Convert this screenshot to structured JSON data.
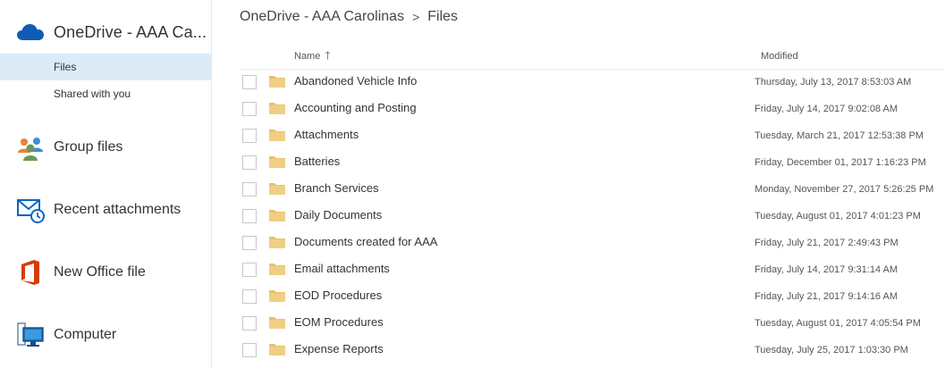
{
  "sidebar": {
    "app_title": "OneDrive - AAA Ca...",
    "sub_items": [
      {
        "label": "Files",
        "selected": true
      },
      {
        "label": "Shared with you",
        "selected": false
      }
    ],
    "nav_items": [
      {
        "label": "Group files",
        "icon": "group-icon"
      },
      {
        "label": "Recent attachments",
        "icon": "mail-clock-icon"
      },
      {
        "label": "New Office file",
        "icon": "office-icon"
      },
      {
        "label": "Computer",
        "icon": "computer-icon"
      }
    ]
  },
  "breadcrumb": {
    "root": "OneDrive - AAA Carolinas",
    "separator": ">",
    "current": "Files"
  },
  "list": {
    "columns": {
      "name": "Name",
      "name_sort_arrow": "🡑",
      "modified": "Modified"
    },
    "rows": [
      {
        "name": "Abandoned Vehicle Info",
        "modified": "Thursday, July 13, 2017 8:53:03 AM"
      },
      {
        "name": "Accounting and Posting",
        "modified": "Friday, July 14, 2017 9:02:08 AM"
      },
      {
        "name": "Attachments",
        "modified": "Tuesday, March 21, 2017 12:53:38 PM"
      },
      {
        "name": "Batteries",
        "modified": "Friday, December 01, 2017 1:16:23 PM"
      },
      {
        "name": "Branch Services",
        "modified": "Monday, November 27, 2017 5:26:25 PM"
      },
      {
        "name": "Daily Documents",
        "modified": "Tuesday, August 01, 2017 4:01:23 PM"
      },
      {
        "name": "Documents created for AAA",
        "modified": "Friday, July 21, 2017 2:49:43 PM"
      },
      {
        "name": "Email attachments",
        "modified": "Friday, July 14, 2017 9:31:14 AM"
      },
      {
        "name": "EOD Procedures",
        "modified": "Friday, July 21, 2017 9:14:16 AM"
      },
      {
        "name": "EOM Procedures",
        "modified": "Tuesday, August 01, 2017 4:05:54 PM"
      },
      {
        "name": "Expense Reports",
        "modified": "Tuesday, July 25, 2017 1:03:30 PM"
      }
    ]
  },
  "colors": {
    "selected_bg": "#dcebf7",
    "onedrive_blue": "#0f5cb5",
    "folder_yellow": "#e8c170",
    "office_orange": "#d83b01",
    "mail_blue": "#0a64c8"
  }
}
